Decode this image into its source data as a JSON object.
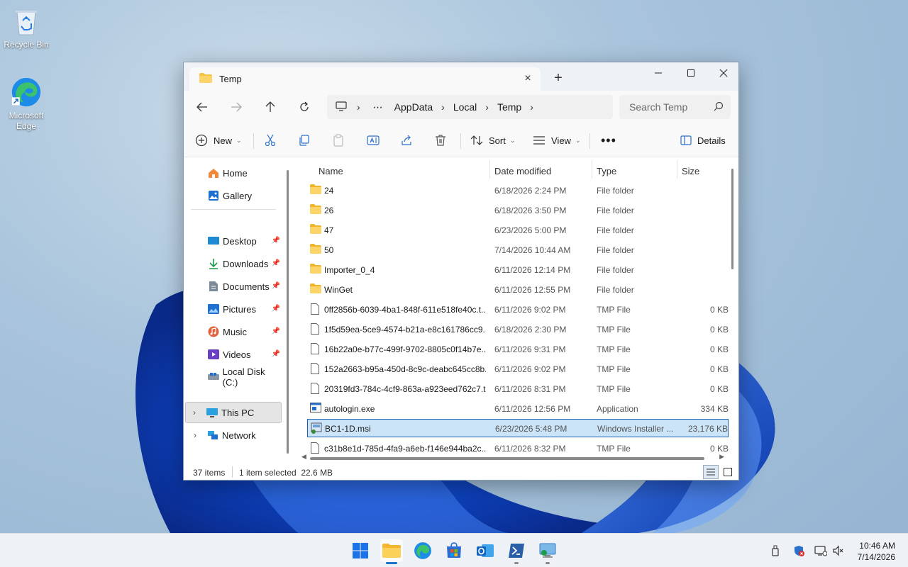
{
  "desktop": {
    "icons": [
      {
        "label": "Recycle Bin",
        "icon": "recycle-bin-icon"
      },
      {
        "label": "Microsoft Edge",
        "icon": "edge-icon"
      }
    ]
  },
  "window": {
    "tab_title": "Temp",
    "breadcrumbs": [
      "AppData",
      "Local",
      "Temp"
    ],
    "search_placeholder": "Search Temp",
    "toolbar": {
      "new_label": "New",
      "sort_label": "Sort",
      "view_label": "View",
      "details_label": "Details"
    },
    "sidebar": {
      "quick": [
        {
          "label": "Home",
          "icon": "home-icon"
        },
        {
          "label": "Gallery",
          "icon": "gallery-icon"
        }
      ],
      "pinned": [
        {
          "label": "Desktop",
          "icon": "desktop-icon"
        },
        {
          "label": "Downloads",
          "icon": "downloads-icon"
        },
        {
          "label": "Documents",
          "icon": "documents-icon"
        },
        {
          "label": "Pictures",
          "icon": "pictures-icon"
        },
        {
          "label": "Music",
          "icon": "music-icon"
        },
        {
          "label": "Videos",
          "icon": "videos-icon"
        },
        {
          "label": "Local Disk (C:)",
          "icon": "drive-icon"
        }
      ],
      "tree": [
        {
          "label": "This PC",
          "icon": "this-pc-icon"
        },
        {
          "label": "Network",
          "icon": "network-icon"
        }
      ]
    },
    "columns": [
      "Name",
      "Date modified",
      "Type",
      "Size"
    ],
    "files": [
      {
        "name": "24",
        "date": "6/18/2026 2:24 PM",
        "type": "File folder",
        "size": "",
        "kind": "folder"
      },
      {
        "name": "26",
        "date": "6/18/2026 3:50 PM",
        "type": "File folder",
        "size": "",
        "kind": "folder"
      },
      {
        "name": "47",
        "date": "6/23/2026 5:00 PM",
        "type": "File folder",
        "size": "",
        "kind": "folder"
      },
      {
        "name": "50",
        "date": "7/14/2026 10:44 AM",
        "type": "File folder",
        "size": "",
        "kind": "folder"
      },
      {
        "name": "Importer_0_4",
        "date": "6/11/2026 12:14 PM",
        "type": "File folder",
        "size": "",
        "kind": "folder"
      },
      {
        "name": "WinGet",
        "date": "6/11/2026 12:55 PM",
        "type": "File folder",
        "size": "",
        "kind": "folder"
      },
      {
        "name": "0ff2856b-6039-4ba1-848f-611e518fe40c.t...",
        "date": "6/11/2026 9:02 PM",
        "type": "TMP File",
        "size": "0 KB",
        "kind": "file"
      },
      {
        "name": "1f5d59ea-5ce9-4574-b21a-e8c161786cc9....",
        "date": "6/18/2026 2:30 PM",
        "type": "TMP File",
        "size": "0 KB",
        "kind": "file"
      },
      {
        "name": "16b22a0e-b77c-499f-9702-8805c0f14b7e....",
        "date": "6/11/2026 9:31 PM",
        "type": "TMP File",
        "size": "0 KB",
        "kind": "file"
      },
      {
        "name": "152a2663-b95a-450d-8c9c-deabc645cc8b...",
        "date": "6/11/2026 9:02 PM",
        "type": "TMP File",
        "size": "0 KB",
        "kind": "file"
      },
      {
        "name": "20319fd3-784c-4cf9-863a-a923eed762c7.t...",
        "date": "6/11/2026 8:31 PM",
        "type": "TMP File",
        "size": "0 KB",
        "kind": "file"
      },
      {
        "name": "autologin.exe",
        "date": "6/11/2026 12:56 PM",
        "type": "Application",
        "size": "334 KB",
        "kind": "exe"
      },
      {
        "name": "BC1-1D.msi",
        "date": "6/23/2026 5:48 PM",
        "type": "Windows Installer ...",
        "size": "23,176 KB",
        "kind": "msi",
        "selected": true
      },
      {
        "name": "c31b8e1d-785d-4fa9-a6eb-f146e944ba2c....",
        "date": "6/11/2026 8:32 PM",
        "type": "TMP File",
        "size": "0 KB",
        "kind": "file"
      }
    ],
    "status": {
      "items": "37 items",
      "selection": "1 item selected  22.6 MB"
    }
  },
  "taskbar": {
    "apps": [
      {
        "name": "start-button",
        "icon": "windows-logo-icon"
      },
      {
        "name": "file-explorer",
        "icon": "folder-icon",
        "active": true
      },
      {
        "name": "edge",
        "icon": "edge-icon"
      },
      {
        "name": "store",
        "icon": "store-icon"
      },
      {
        "name": "outlook",
        "icon": "outlook-icon"
      },
      {
        "name": "powershell",
        "icon": "terminal-icon"
      },
      {
        "name": "remote-desktop",
        "icon": "remote-desktop-icon"
      }
    ],
    "clock": {
      "time": "10:46 AM",
      "date": "7/14/2026"
    }
  },
  "colors": {
    "accent": "#1a5fb4",
    "selection": "#cce4f7",
    "folder": "#f5c242"
  }
}
